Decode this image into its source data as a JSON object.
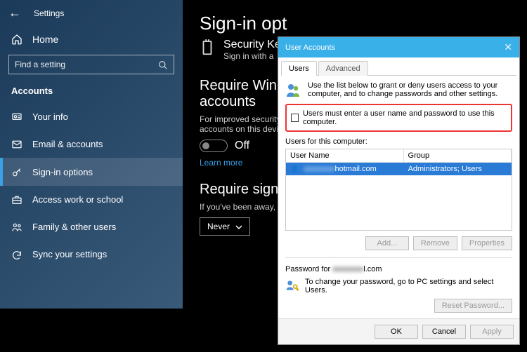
{
  "settings": {
    "app_title": "Settings",
    "home_label": "Home",
    "search_placeholder": "Find a setting",
    "section": "Accounts",
    "nav": [
      {
        "icon": "user",
        "label": "Your info"
      },
      {
        "icon": "mail",
        "label": "Email & accounts"
      },
      {
        "icon": "key",
        "label": "Sign-in options"
      },
      {
        "icon": "briefcase",
        "label": "Access work or school"
      },
      {
        "icon": "family",
        "label": "Family & other users"
      },
      {
        "icon": "sync",
        "label": "Sync your settings"
      }
    ],
    "active_nav_index": 2
  },
  "content": {
    "page_title": "Sign-in opt",
    "security_key_label": "Security Key",
    "security_key_sub": "Sign in with a",
    "require_ms_heading": "Require Window\naccounts",
    "require_ms_body": "For improved security\naccounts on this devic",
    "toggle_state": "Off",
    "learn_more": "Learn more",
    "require_signin_heading": "Require sign-in",
    "require_signin_body": "If you've been away, v",
    "never_label": "Never"
  },
  "dialog": {
    "title": "User Accounts",
    "tabs": {
      "users": "Users",
      "advanced": "Advanced"
    },
    "intro": "Use the list below to grant or deny users access to your computer, and to change passwords and other settings.",
    "must_enter_label": "Users must enter a user name and password to use this computer.",
    "users_for_label": "Users for this computer:",
    "columns": {
      "name": "User Name",
      "group": "Group"
    },
    "row": {
      "name_blur": "xxxxxxxx",
      "name_suffix": "hotmail.com",
      "group": "Administrators; Users"
    },
    "btn_add": "Add...",
    "btn_remove": "Remove",
    "btn_props": "Properties",
    "pw_for_prefix": "Password for ",
    "pw_for_suffix": "l.com",
    "pw_msg": "To change your password, go to PC settings and select Users.",
    "btn_reset": "Reset Password...",
    "btn_ok": "OK",
    "btn_cancel": "Cancel",
    "btn_apply": "Apply"
  }
}
